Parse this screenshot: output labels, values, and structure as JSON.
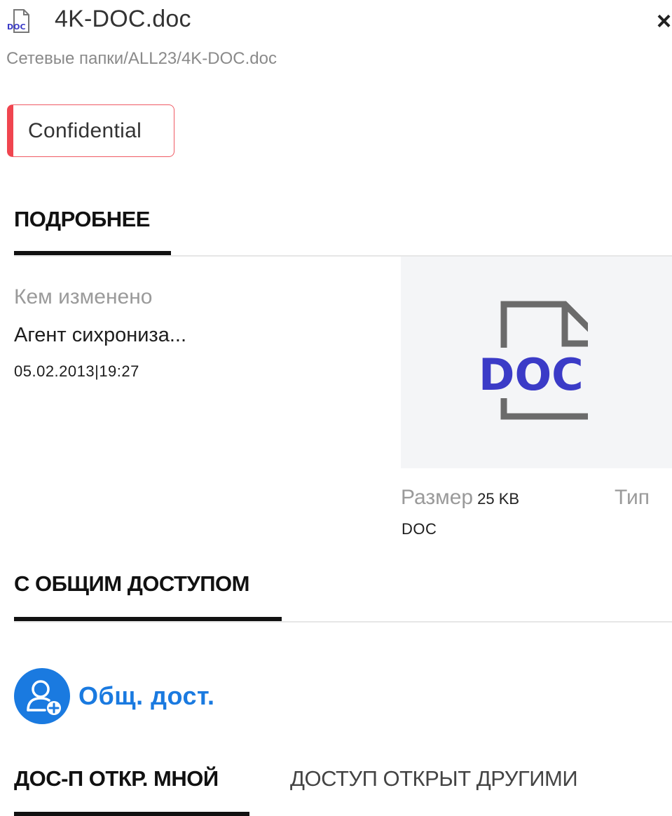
{
  "header": {
    "file_icon": "doc-file-icon",
    "file_name": "4K-DOC.doc",
    "close_label": "×",
    "path": "Сетевые папки/ALL23/4K-DOC.doc"
  },
  "badge": {
    "label": "Confidential",
    "color": "#f0454f"
  },
  "details": {
    "title": "ПОДРОБНЕЕ",
    "modified_by_label": "Кем изменено",
    "modified_by_value": "Агент сихрониза...",
    "modified_at": "05.02.2013|19:27",
    "preview_text": "DOC",
    "size_label": "Размер",
    "size_value": "25 KB",
    "type_label": "Тип",
    "type_value": "DOC"
  },
  "sharing": {
    "title": "С ОБЩИМ ДОСТУПОМ",
    "share_button_label": "Общ. дост.",
    "share_icon": "add-user-icon",
    "accent": "#1a7ae0"
  },
  "tabs": [
    {
      "label": "ДОС-П ОТКР. МНОЙ",
      "active": true
    },
    {
      "label": "ДОСТУП ОТКРЫТ ДРУГИМИ",
      "active": false
    }
  ]
}
